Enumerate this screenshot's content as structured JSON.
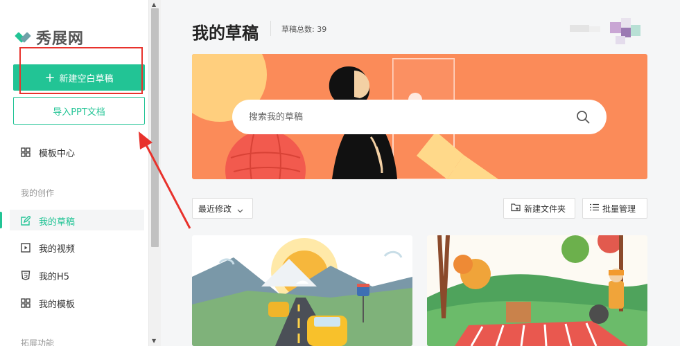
{
  "app": {
    "name": "秀展网"
  },
  "sidebar": {
    "new_blank_label": "新建空白草稿",
    "import_ppt_label": "导入PPT文档",
    "template_center_label": "模板中心",
    "section_creation": "我的创作",
    "items": [
      {
        "label": "我的草稿",
        "icon": "edit-icon",
        "active": true
      },
      {
        "label": "我的视频",
        "icon": "video-icon",
        "active": false
      },
      {
        "label": "我的H5",
        "icon": "h5-icon",
        "active": false
      },
      {
        "label": "我的模板",
        "icon": "template-grid-icon",
        "active": false
      }
    ],
    "section_extension": "拓展功能"
  },
  "header": {
    "title": "我的草稿",
    "count_label": "草稿总数: 39"
  },
  "search": {
    "placeholder": "搜索我的草稿"
  },
  "toolbar": {
    "sort_label": "最近修改",
    "new_folder_label": "新建文件夹",
    "batch_label": "批量管理"
  },
  "colors": {
    "accent": "#22c495",
    "banner": "#fb8b59",
    "annotation": "#e8322c"
  }
}
